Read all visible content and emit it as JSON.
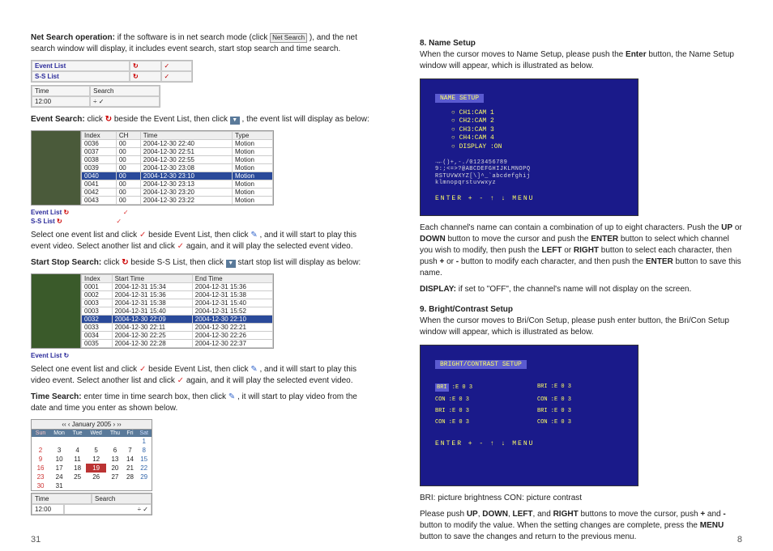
{
  "left": {
    "intro_strong": "Net Search operation:",
    "intro_text1": " if the software is in net search mode (click ",
    "intro_btn": "Net Search",
    "intro_text2": " ), and the net search window will display, it includes event search, start stop search and time search.",
    "bar1": {
      "r1c1": "Event List",
      "r1c2": "↻",
      "r1c3": "✓",
      "r2c1": "S-S   List",
      "r2c2": "↻",
      "r2c3": "✓"
    },
    "bar2": {
      "h1": "Time",
      "h2": "Search",
      "v1": "12:00",
      "v2": "÷ ✓"
    },
    "eventsearch": {
      "label": "Event Search:",
      "t1": " click ",
      "t2": " beside the Event List, then click ",
      "t3": " , the event list will display as below:"
    },
    "eventtable": {
      "headers": [
        "Index",
        "CH",
        "Time",
        "Type"
      ],
      "rows": [
        [
          "0036",
          "00",
          "2004-12-30 22:40",
          "Motion"
        ],
        [
          "0037",
          "00",
          "2004-12-30 22:51",
          "Motion"
        ],
        [
          "0038",
          "00",
          "2004-12-30 22:55",
          "Motion"
        ],
        [
          "0039",
          "00",
          "2004-12-30 23:08",
          "Motion"
        ],
        [
          "0040",
          "00",
          "2004-12-30 23:10",
          "Motion"
        ],
        [
          "0041",
          "00",
          "2004-12-30 23:13",
          "Motion"
        ],
        [
          "0042",
          "00",
          "2004-12-30 23:20",
          "Motion"
        ],
        [
          "0043",
          "00",
          "2004-12-30 23:22",
          "Motion"
        ]
      ],
      "sel": 4
    },
    "below_event": {
      "a": "Event List",
      "b": "S-S   List"
    },
    "select1_a": "Select one event list and click ",
    "select1_b": " beside Event List, then click ",
    "select1_c": " , and it will start to play this event video. Select another list and click ",
    "select1_d": " again, and it will play the selected event video.",
    "sssearch": {
      "label": "Start Stop Search:",
      "t1": " click ",
      "t2": " beside S-S List, then click ",
      "t3": "  start stop list will display as below:"
    },
    "sstable": {
      "headers": [
        "Index",
        "Start Time",
        "End Time"
      ],
      "rows": [
        [
          "0001",
          "2004-12-31 15:34",
          "2004-12-31 15:36"
        ],
        [
          "0002",
          "2004-12-31 15:36",
          "2004-12-31 15:38"
        ],
        [
          "0003",
          "2004-12-31 15:38",
          "2004-12-31 15:40"
        ],
        [
          "0003",
          "2004-12-31 15:40",
          "2004-12-31 15:52"
        ],
        [
          "0032",
          "2004-12-30 22:09",
          "2004-12-30 22:10"
        ],
        [
          "0033",
          "2004-12-30 22:11",
          "2004-12-30 22:21"
        ],
        [
          "0034",
          "2004-12-30 22:25",
          "2004-12-30 22:26"
        ],
        [
          "0035",
          "2004-12-30 22:28",
          "2004-12-30 22:37"
        ]
      ],
      "sel": 4
    },
    "ss_footer": "Event List  ↻",
    "select2_a": "Select one event list and click ",
    "select2_b": " beside Event List, then click ",
    "select2_c": " , and it will start to play this video event. Select another list and click ",
    "select2_d": " again, and it will play the selected event video.",
    "timesearch": {
      "label": "Time Search:",
      "t1": " enter time in time search box, then click ",
      "t2": " , it will start to play video from the date and time you enter as shown below."
    },
    "calendar": {
      "title": "‹‹ ‹ January 2005 › ››",
      "days": [
        "Sun",
        "Mon",
        "Tue",
        "Wed",
        "Thu",
        "Fri",
        "Sat"
      ],
      "weeks": [
        [
          "",
          "",
          "",
          "",
          "",
          "",
          "1"
        ],
        [
          "2",
          "3",
          "4",
          "5",
          "6",
          "7",
          "8"
        ],
        [
          "9",
          "10",
          "11",
          "12",
          "13",
          "14",
          "15"
        ],
        [
          "16",
          "17",
          "18",
          "19",
          "20",
          "21",
          "22"
        ],
        [
          "23",
          "24",
          "25",
          "26",
          "27",
          "28",
          "29"
        ],
        [
          "30",
          "31",
          "",
          "",
          "",
          "",
          ""
        ]
      ],
      "today": "19"
    },
    "timebar": {
      "h1": "Time",
      "h2": "Search",
      "v1": "12:00",
      "v2": "÷ ✓"
    },
    "pagenum": "31"
  },
  "right": {
    "s8": {
      "title": "8. Name Setup",
      "p1a": "When the cursor moves to Name Setup, please push the ",
      "p1b": "Enter",
      "p1c": " button, the Name Setup window will appear, which is illustrated as below.",
      "osd_title": "NAME SETUP",
      "osd_lines": [
        "○ CH1:CAM 1",
        "○ CH2:CAM 2",
        "○ CH3:CAM 3",
        "○ CH4:CAM 4",
        "○ DISPLAY :ON"
      ],
      "osd_txt1": "→←()+,-./0123456789",
      "osd_txt2": "9:;<=>?@ABCDEFGHIJKLMNOPQ",
      "osd_txt3": "RSTUVWXYZ[\\]^_`abcdefghij",
      "osd_txt4": "klmnopqrstuvwxyz",
      "osd_foot": "ENTER  +  -  ↑  ↓  MENU",
      "p2a": "Each channel's name can contain a combination of up to eight characters. Push the ",
      "p2b": "UP",
      "p2c": " or ",
      "p2d": "DOWN",
      "p2e": " button to move the cursor and push the ",
      "p2f": "ENTER",
      "p2g": " button to select which channel you wish to modify, then push the ",
      "p2h": "LEFT",
      "p2i": " or ",
      "p2j": "RIGHT",
      "p2k": " button to select each character, then push ",
      "p2l": "+",
      "p2m": " or ",
      "p2n": "-",
      "p2o": " button to modify each character, and then push the ",
      "p2p": "ENTER",
      "p2q": " button to save this name.",
      "p3a": "DISPLAY:",
      "p3b": " if set to \"OFF\", the channel's name will not display on the screen."
    },
    "s9": {
      "title": "9. Bright/Contrast Setup",
      "p1": "When the cursor moves to Bri/Con Setup, please push enter button, the Bri/Con Setup window will appear, which is illustrated as below.",
      "osd_title": "BRIGHT/CONTRAST SETUP",
      "grid": [
        "BRI :E     0     3",
        "BRI :E     0     3",
        "CON :E     0     3",
        "CON :E     0     3",
        "BRI :E     0     3",
        "BRI :E     0     3",
        "CON :E     0     3",
        "CON :E     0     3"
      ],
      "osd_foot": "ENTER  +  -  ↑  ↓  MENU",
      "p2": "BRI: picture brightness  CON: picture contrast",
      "p3a": "Please push ",
      "p3b": "UP",
      "p3c": ", ",
      "p3d": "DOWN",
      "p3e": ", ",
      "p3f": "LEFT",
      "p3g": ", and ",
      "p3h": "RIGHT",
      "p3i": " buttons to move the cursor, push ",
      "p3j": "+",
      "p3k": " and ",
      "p3l": "-",
      "p3m": " button to modify the value. When the setting changes are complete, press the ",
      "p3n": "MENU",
      "p3o": " button to save the changes and return to the previous menu."
    },
    "pagenum": "8"
  }
}
